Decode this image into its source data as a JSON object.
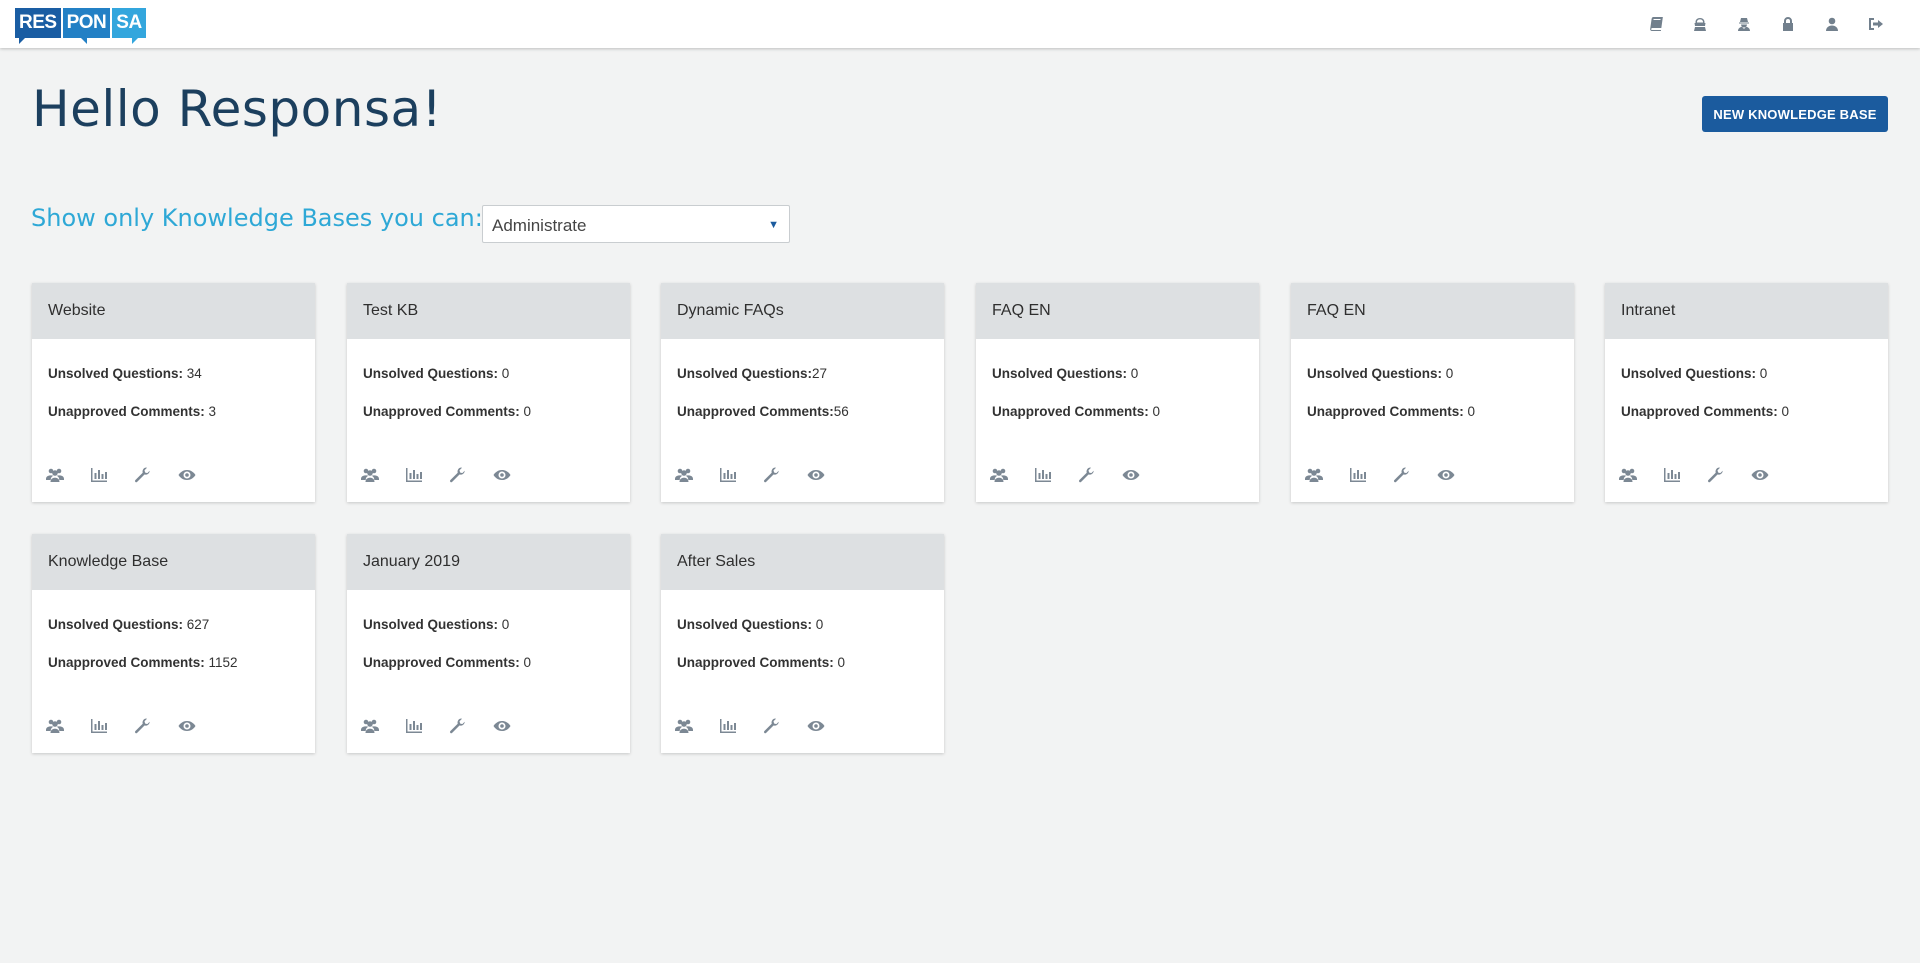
{
  "app": {
    "logo": [
      "RES",
      "PON",
      "SA"
    ]
  },
  "header": {
    "greeting": "Hello Responsa!",
    "new_kb_label": "NEW KNOWLEDGE BASE"
  },
  "top_icons": [
    "book-icon",
    "users-icon",
    "user-secret-icon",
    "lock-icon",
    "user-icon",
    "sign-out-icon"
  ],
  "filter": {
    "label": "Show only Knowledge Bases you can:",
    "selected": "Administrate"
  },
  "labels": {
    "unsolved": "Unsolved Questions:",
    "unapproved": "Unapproved Comments:"
  },
  "card_icons": [
    "users-icon",
    "chart-icon",
    "wrench-icon",
    "eye-icon"
  ],
  "cards": [
    {
      "title": "Website",
      "unsolved": " 34",
      "unapproved": " 3"
    },
    {
      "title": "Test KB",
      "unsolved": " 0",
      "unapproved": " 0"
    },
    {
      "title": "Dynamic FAQs",
      "unsolved": "27",
      "unapproved": "56"
    },
    {
      "title": "FAQ EN",
      "unsolved": " 0",
      "unapproved": " 0"
    },
    {
      "title": "FAQ EN",
      "unsolved": " 0",
      "unapproved": " 0"
    },
    {
      "title": "Intranet",
      "unsolved": " 0",
      "unapproved": " 0"
    },
    {
      "title": "Knowledge Base",
      "unsolved": " 627",
      "unapproved": " 1152"
    },
    {
      "title": "January 2019",
      "unsolved": " 0",
      "unapproved": " 0"
    },
    {
      "title": "After Sales",
      "unsolved": " 0",
      "unapproved": " 0"
    }
  ],
  "colors": {
    "primary": "#1b5b9e",
    "accent": "#2ea8d6",
    "heading": "#1c3f5e",
    "card_header": "#dde0e2",
    "background": "#f2f3f3"
  }
}
